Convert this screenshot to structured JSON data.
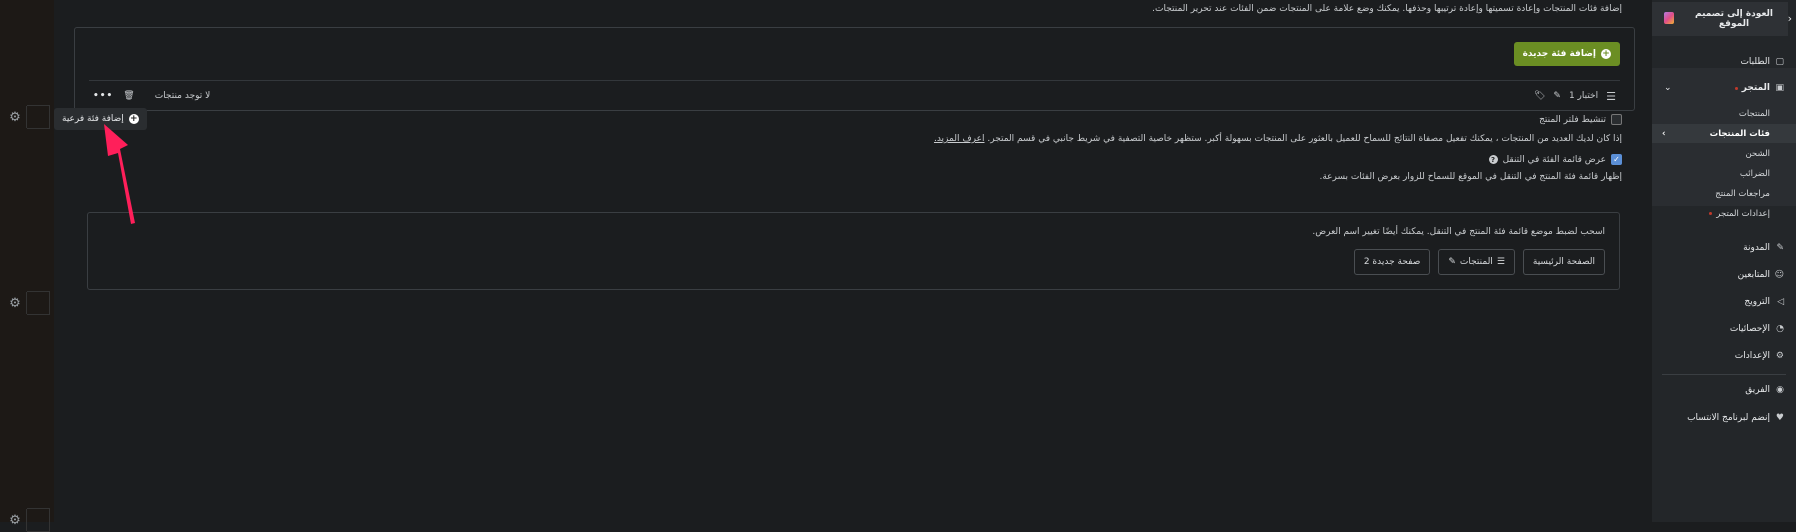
{
  "intro_text": "إضافة فئات المنتجات وإعادة تسميتها وإعادة ترتيبها وحذفها. يمكنك وضع علامة على المنتجات ضمن الفئات عند تحرير المنتجات.",
  "add_category_button": "إضافة فئة جديدة",
  "category_row": {
    "name": "اختبار 1",
    "no_products": "لا توجد منتجات"
  },
  "subcategory_tooltip": "إضافة فئة فرعية",
  "filter": {
    "label": "تنشيط فلتر المنتج",
    "checked": false,
    "description": "إذا كان لديك العديد من المنتجات ، يمكنك تفعيل مصفاة النتائج للسماح للعميل بالعثور على المنتجات بسهولة أكبر. ستظهر خاصية التصفية في شريط جانبي في قسم المتجر.",
    "learn_more": "اعرف المزيد."
  },
  "nav_menu": {
    "label": "عرض قائمة الفئة في التنقل",
    "checked": true,
    "description": "إظهار قائمة فئة المنتج في التنقل في الموقع للسماح للزوار بعرض الفئات بسرعة.",
    "help": "اسحب لضبط موضع قائمة فئة المنتج في التنقل. يمكنك أيضًا تغيير اسم العرض.",
    "items": [
      "الصفحة الرئيسية",
      "المنتجات",
      "صفحة جديدة 2"
    ]
  },
  "sidebar": {
    "back_label": "العودة إلى تصميم الموقع",
    "orders": "الطلبات",
    "store": "المتجر",
    "store_sub": [
      "المنتجات",
      "فئات المنتجات",
      "الشحن",
      "الضرائب",
      "مراجعات المنتج",
      "إعدادات المتجر"
    ],
    "blog": "المدونة",
    "followers": "المتابعين",
    "promotion": "الترويج",
    "stats": "الإحصائيات",
    "settings": "الإعدادات",
    "team": "الفريق",
    "affiliate": "إنضم لبرنامج الانتساب"
  },
  "colors": {
    "accent_green": "#6b8e23",
    "highlight_arrow": "#ff1f5a",
    "checkbox_blue": "#5b8fd6"
  }
}
